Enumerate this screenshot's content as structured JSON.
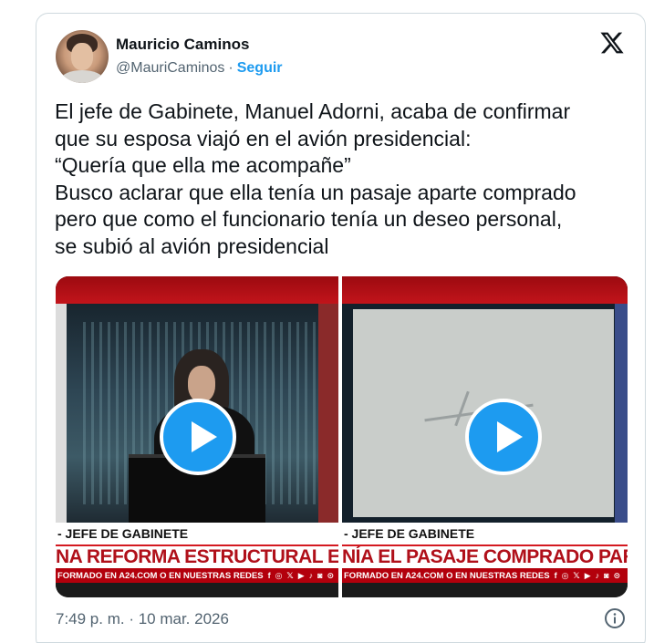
{
  "author": {
    "display_name": "Mauricio Caminos",
    "handle": "@MauriCaminos",
    "separator": "·",
    "follow_label": "Seguir"
  },
  "tweet": {
    "text": "El jefe de Gabinete, Manuel Adorni, acaba de confirmar\nque su esposa viajó en el avión presidencial:\n“Quería que ella me acompañe”\nBusco aclarar que ella tenía un pasaje aparte comprado\npero que como el funcionario tenía un deseo personal,\nse subió al avión presidencial",
    "timestamp": "7:49 p. m. · 10 mar. 2026"
  },
  "media": {
    "left": {
      "caption": "- JEFE DE GABINETE",
      "headline": "NA REFORMA ESTRUCTURAL EN EL I",
      "ticker": "FORMADO EN A24.COM O EN NUESTRAS REDES"
    },
    "right": {
      "caption": "- JEFE DE GABINETE",
      "headline": "NÍA EL PASAJE COMPRADO PARA VE",
      "ticker": "FORMADO EN A24.COM O EN NUESTRAS REDES"
    },
    "social_icons": [
      "f",
      "◎",
      "𝕏",
      "▶",
      "♪",
      "◙",
      "⊙"
    ]
  },
  "icons": {
    "logo": "x-logo-icon",
    "play": "play-icon",
    "info": "info-icon"
  },
  "colors": {
    "accent": "#1d9bf0",
    "text": "#0f1419",
    "muted": "#536471",
    "border": "#cfd9de",
    "news_red": "#b3000c"
  }
}
